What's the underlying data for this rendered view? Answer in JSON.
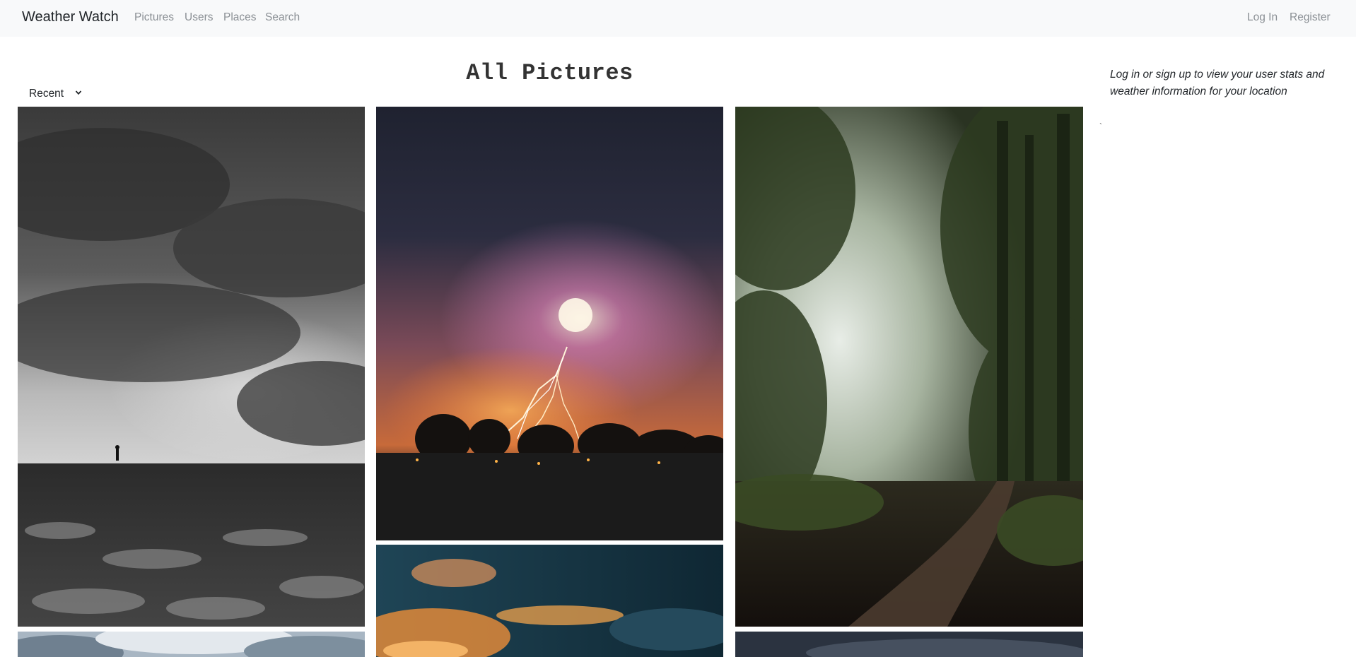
{
  "navbar": {
    "brand": "Weather Watch",
    "links": [
      "Pictures",
      "Users",
      "Places",
      "Search"
    ],
    "auth": [
      "Log In",
      "Register"
    ]
  },
  "main": {
    "title": "All Pictures",
    "sort": {
      "selected": "Recent",
      "icon": "chevron-down-icon"
    }
  },
  "sidebar": {
    "message": "Log in or sign up to view your user stats and weather information for your location",
    "mark": "`"
  },
  "colors": {
    "navbar_bg": "#f8f9fa",
    "nav_link": "#8a8f94",
    "text": "#212529"
  }
}
